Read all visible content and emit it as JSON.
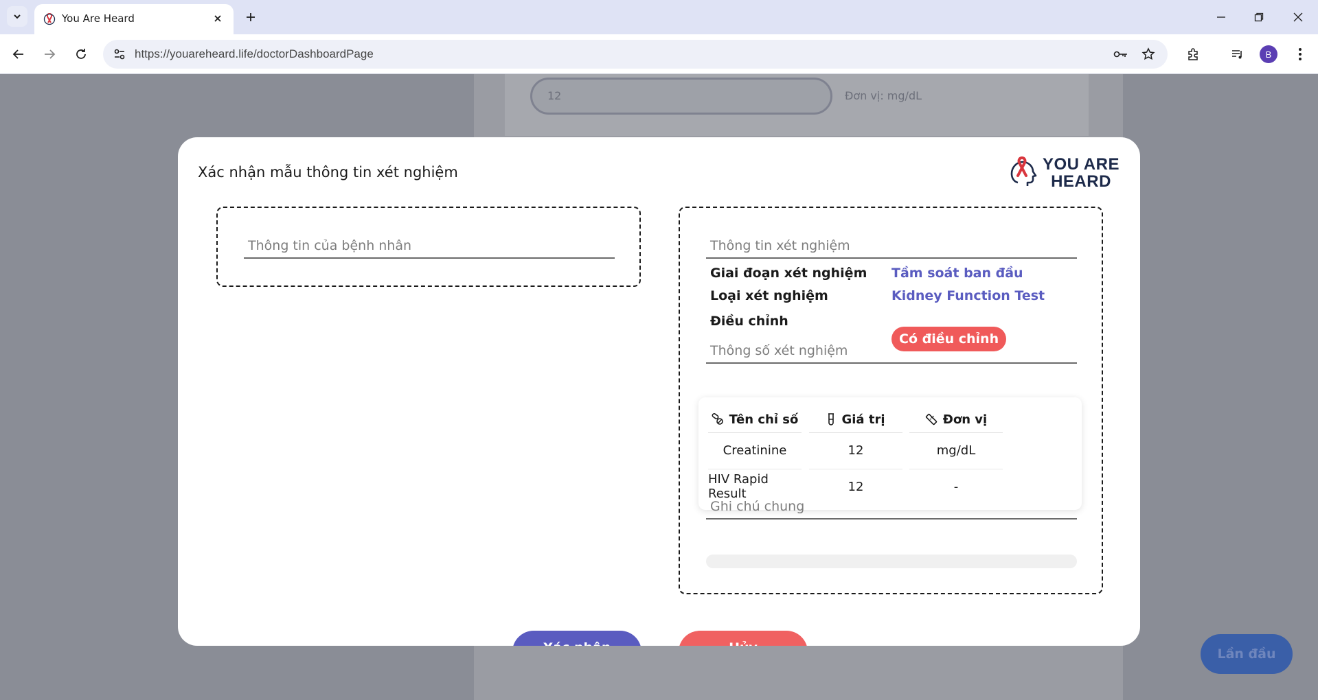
{
  "browser": {
    "tab_title": "You Are Heard",
    "url_host": "https://youareheard.life",
    "url_path": "/doctorDashboardPage",
    "avatar_letter": "B"
  },
  "background": {
    "input_value": "12",
    "unit_text": "Đơn vị: mg/dL",
    "fab_label": "Lần đầu"
  },
  "modal": {
    "title": "Xác nhận mẫu thông tin xét nghiệm",
    "logo_line1": "YOU ARE",
    "logo_line2": "HEARD",
    "patient_section_title": "Thông tin của bệnh nhân",
    "test_section_title": "Thông tin xét nghiệm",
    "test_info": {
      "stage_label": "Giai đoạn xét nghiệm",
      "stage_value": "Tầm soát ban đầu",
      "type_label": "Loại xét nghiệm",
      "type_value": "Kidney Function Test",
      "adjust_label": "Điều chỉnh",
      "adjust_badge": "Có điều chỉnh"
    },
    "params_section_title": "Thông số xét nghiệm",
    "table": {
      "headers": [
        "Tên chỉ số",
        "Giá trị",
        "Đơn vị"
      ],
      "rows": [
        [
          "Creatinine",
          "12",
          "mg/dL"
        ],
        [
          "HIV Rapid Result",
          "12",
          "-"
        ]
      ]
    },
    "notes_section_title": "Ghi chú chung",
    "confirm_button": "Xác nhận",
    "cancel_button": "Hủy"
  },
  "colors": {
    "accent": "#5a5cc0",
    "danger": "#f05a5a"
  }
}
